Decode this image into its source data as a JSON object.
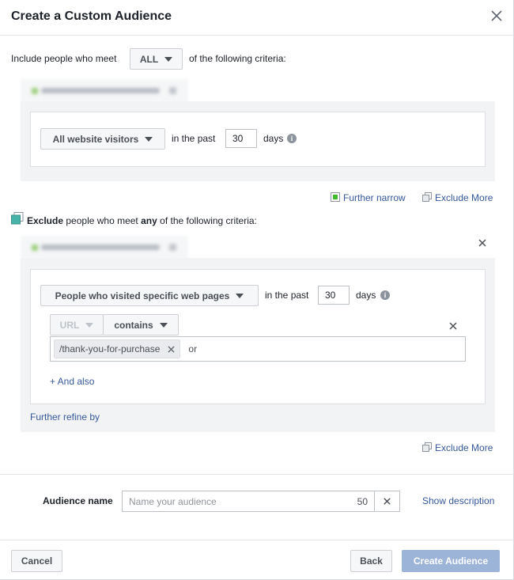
{
  "dialog": {
    "title": "Create a Custom Audience"
  },
  "include": {
    "prefix": "Include people who meet",
    "match": "ALL",
    "suffix": "of the following criteria:",
    "rule": {
      "source": "All website visitors",
      "in_the_past": "in the past",
      "days_value": "30",
      "days_label": "days"
    },
    "further_narrow": "Further narrow",
    "exclude_more": "Exclude More"
  },
  "exclude": {
    "keyword": "Exclude",
    "middle": "people who meet",
    "match": "any",
    "suffix": "of the following criteria:",
    "rule": {
      "source": "People who visited specific web pages",
      "in_the_past": "in the past",
      "days_value": "30",
      "days_label": "days",
      "field": "URL",
      "operator": "contains",
      "token": "/thank-you-for-purchase",
      "or_label": "or",
      "and_also": "+ And also"
    },
    "further_refine": "Further refine by",
    "exclude_more": "Exclude More"
  },
  "audience_name": {
    "label": "Audience name",
    "placeholder": "Name your audience",
    "char_count": "50",
    "show_description": "Show description"
  },
  "footer": {
    "cancel": "Cancel",
    "back": "Back",
    "create": "Create Audience"
  },
  "colors": {
    "link": "#365899",
    "primary_disabled": "#9cb4d8",
    "panel": "#f2f3f5"
  }
}
